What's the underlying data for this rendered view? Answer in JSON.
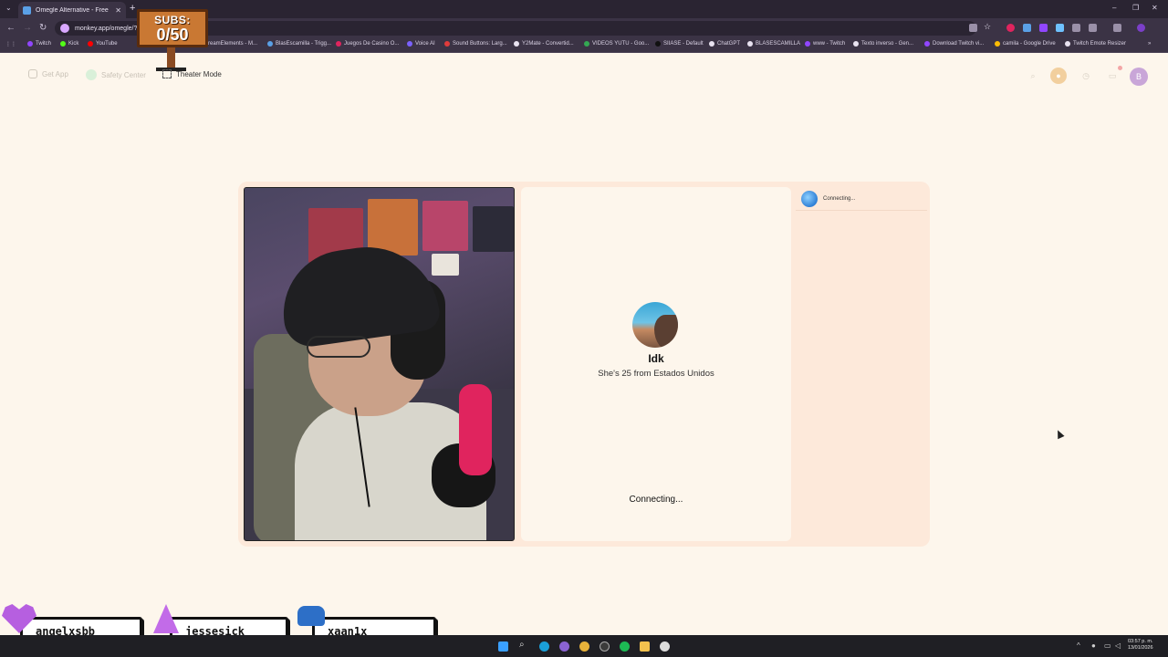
{
  "browser": {
    "tab_title": "Omegle Alternative - Free",
    "tab_menu": "⌄",
    "new_tab": "+",
    "url": "monkey.app/omegle/?",
    "window_controls": [
      "–",
      "❐",
      "✕"
    ],
    "bookmarks": [
      {
        "label": "Twitch",
        "color": "#9146ff"
      },
      {
        "label": "Kick",
        "color": "#53fc18"
      },
      {
        "label": "YouTube",
        "color": "#ff0000"
      },
      {
        "label": "reamElements - M...",
        "color": "#e8e2f0"
      },
      {
        "label": "BlasEscamilla - Trigg...",
        "color": "#5aa0e6"
      },
      {
        "label": "Juegos De Casino O...",
        "color": "#e0245e"
      },
      {
        "label": "Voice AI",
        "color": "#7b61ff"
      },
      {
        "label": "Sound Buttons: Larg...",
        "color": "#e03b3b"
      },
      {
        "label": "Y2Mate - Convertid...",
        "color": "#e8e2f0"
      },
      {
        "label": "VIDEOS YUTU - Goo...",
        "color": "#34a853"
      },
      {
        "label": "SIIASE - Default",
        "color": "#222222"
      },
      {
        "label": "ChatGPT",
        "color": "#e8e2f0"
      },
      {
        "label": "BLASESCAMILLA",
        "color": "#e8e2f0"
      },
      {
        "label": "www - Twitch",
        "color": "#9146ff"
      },
      {
        "label": "Texto inverso - Gen...",
        "color": "#e8e2f0"
      },
      {
        "label": "Download Twitch vi...",
        "color": "#9146ff"
      },
      {
        "label": "camila - Google Drive",
        "color": "#fbbc04"
      },
      {
        "label": "Twitch Emote Resizer",
        "color": "#e8e2f0"
      }
    ]
  },
  "overlay": {
    "subs_label": "SUBS:",
    "subs_count": "0/50",
    "chatters": [
      "angelxsbb",
      "jessesick",
      "xaan1x"
    ]
  },
  "header": {
    "get_app": "Get App",
    "safety_center": "Safety Center",
    "theater_mode": "Theater Mode",
    "profile_initial": "B"
  },
  "match": {
    "name": "Idk",
    "description": "She's 25 from Estados Unidos",
    "status": "Connecting...",
    "side_status": "Connecting..."
  },
  "taskbar": {
    "time": "03:57 p. m.",
    "date": "13/01/2026",
    "tray_arrow": "^"
  }
}
